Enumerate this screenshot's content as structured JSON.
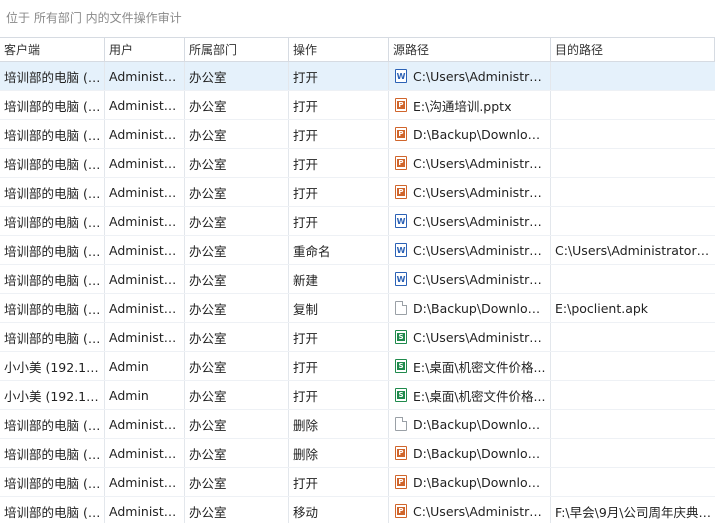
{
  "title": "位于 所有部门 内的文件操作审计",
  "columns": {
    "client": "客户端",
    "user": "用户",
    "dept": "所属部门",
    "op": "操作",
    "src": "源路径",
    "dst": "目的路径"
  },
  "rows": [
    {
      "client": "培训部的电脑 (1...",
      "user": "Administra...",
      "dept": "办公室",
      "op": "打开",
      "icon": "word-file-icon",
      "src": "C:\\Users\\Administrat...",
      "dst": "",
      "selected": true
    },
    {
      "client": "培训部的电脑 (1...",
      "user": "Administra...",
      "dept": "办公室",
      "op": "打开",
      "icon": "powerpoint-file-icon",
      "src": "E:\\沟通培训.pptx",
      "dst": ""
    },
    {
      "client": "培训部的电脑 (1...",
      "user": "Administra...",
      "dept": "办公室",
      "op": "打开",
      "icon": "powerpoint-file-icon",
      "src": "D:\\Backup\\Download...",
      "dst": ""
    },
    {
      "client": "培训部的电脑 (1...",
      "user": "Administra...",
      "dept": "办公室",
      "op": "打开",
      "icon": "powerpoint-file-icon",
      "src": "C:\\Users\\Administrat...",
      "dst": ""
    },
    {
      "client": "培训部的电脑 (1...",
      "user": "Administra...",
      "dept": "办公室",
      "op": "打开",
      "icon": "powerpoint-file-icon",
      "src": "C:\\Users\\Administrat...",
      "dst": ""
    },
    {
      "client": "培训部的电脑 (1...",
      "user": "Administra...",
      "dept": "办公室",
      "op": "打开",
      "icon": "word-file-icon",
      "src": "C:\\Users\\Administrat...",
      "dst": ""
    },
    {
      "client": "培训部的电脑 (1...",
      "user": "Administra...",
      "dept": "办公室",
      "op": "重命名",
      "icon": "word-file-icon",
      "src": "C:\\Users\\Administrat...",
      "dst": "C:\\Users\\Administrator\\D..."
    },
    {
      "client": "培训部的电脑 (1...",
      "user": "Administra...",
      "dept": "办公室",
      "op": "新建",
      "icon": "word-file-icon",
      "src": "C:\\Users\\Administrat...",
      "dst": ""
    },
    {
      "client": "培训部的电脑 (1...",
      "user": "Administra...",
      "dept": "办公室",
      "op": "复制",
      "icon": "generic-file-icon",
      "src": "D:\\Backup\\Downloa...",
      "dst": "E:\\poclient.apk"
    },
    {
      "client": "培训部的电脑 (1...",
      "user": "Administra...",
      "dept": "办公室",
      "op": "打开",
      "icon": "excel-file-icon",
      "src": "C:\\Users\\Administrat...",
      "dst": ""
    },
    {
      "client": "小小美 (192.16...",
      "user": "Admin",
      "dept": "办公室",
      "op": "打开",
      "icon": "excel-file-icon",
      "src": "E:\\桌面\\机密文件价格...",
      "dst": ""
    },
    {
      "client": "小小美 (192.16...",
      "user": "Admin",
      "dept": "办公室",
      "op": "打开",
      "icon": "excel-file-icon",
      "src": "E:\\桌面\\机密文件价格...",
      "dst": ""
    },
    {
      "client": "培训部的电脑 (1...",
      "user": "Administra...",
      "dept": "办公室",
      "op": "删除",
      "icon": "generic-file-icon",
      "src": "D:\\Backup\\Downloa...",
      "dst": ""
    },
    {
      "client": "培训部的电脑 (1...",
      "user": "Administra...",
      "dept": "办公室",
      "op": "删除",
      "icon": "powerpoint-file-icon",
      "src": "D:\\Backup\\Download...",
      "dst": ""
    },
    {
      "client": "培训部的电脑 (1...",
      "user": "Administra...",
      "dept": "办公室",
      "op": "打开",
      "icon": "powerpoint-file-icon",
      "src": "D:\\Backup\\Download...",
      "dst": ""
    },
    {
      "client": "培训部的电脑 (1...",
      "user": "Administra...",
      "dept": "办公室",
      "op": "移动",
      "icon": "powerpoint-file-icon",
      "src": "C:\\Users\\Administrat...",
      "dst": "F:\\早会\\9月\\公司周年庆典0..."
    }
  ]
}
